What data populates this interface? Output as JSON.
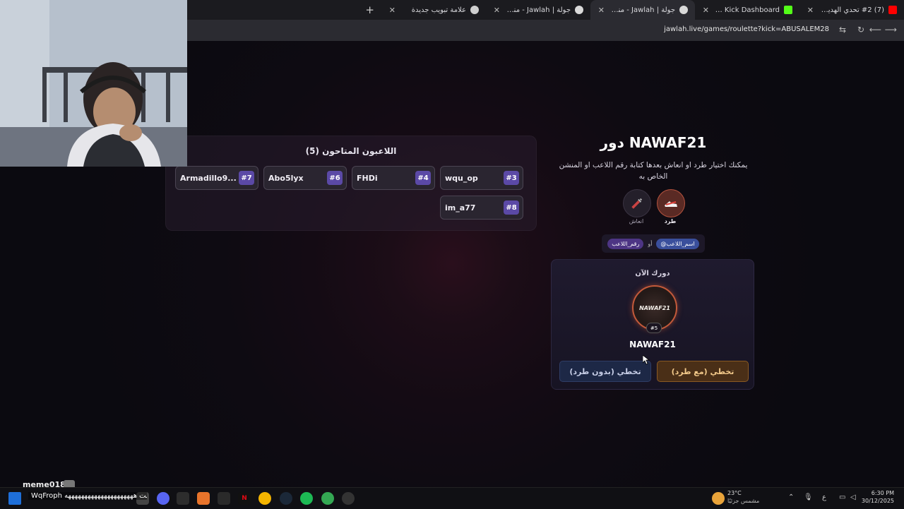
{
  "browser": {
    "tabs": [
      {
        "title": "(7) #2 تحدي الهدية الغامضة بين",
        "favicon_color": "#ff0000",
        "icon": "youtube-icon"
      },
      {
        "title": "Stream - Kick Dashboard",
        "favicon_color": "#53fc18",
        "icon": "kick-icon"
      },
      {
        "title": "جولة | Jawlah - منصة الألعاب الـ",
        "favicon_color": "#d9d9d9",
        "icon": "jawlah-icon",
        "active": true
      },
      {
        "title": "جولة | Jawlah - منصة الألعاب الـ",
        "favicon_color": "#d9d9d9",
        "icon": "jawlah-icon"
      },
      {
        "title": "علامة تبويب جديدة",
        "favicon_color": "#cfcfcf",
        "icon": "chrome-icon"
      }
    ],
    "new_tab_symbol": "+",
    "url": "jawlah.live/games/roulette?kick=ABUSALEM28"
  },
  "players": {
    "title": "اللاعبون المتاحون (5)",
    "list": [
      {
        "name": "wqu_op",
        "num": "#3"
      },
      {
        "name": "FHDi",
        "num": "#4"
      },
      {
        "name": "Abo5lyx",
        "num": "#6"
      },
      {
        "name": "Armadillo9...",
        "num": "#7"
      },
      {
        "name": "im_a77",
        "num": "#8"
      }
    ]
  },
  "turn": {
    "title": "دور NAWAF21",
    "description": "يمكنك اختيار طرد او انعاش بعدها كتابة رقم اللاعب او المنشن الخاص به",
    "options": [
      {
        "label": "طرد",
        "icon": "kick-shoe-icon"
      },
      {
        "label": "انعاش",
        "icon": "syringe-icon"
      }
    ],
    "hint": {
      "chip1": "@اسم_اللاعب",
      "or": "أو",
      "chip2": "رقم_اللاعب"
    }
  },
  "current": {
    "label": "دورك الآن",
    "avatar_text": "NAWAF21",
    "badge": "#5",
    "name": "NAWAF21",
    "skip_with_kick": "تخطي (مع طرد)",
    "skip_without_kick": "تخطي (بدون طرد)"
  },
  "overlay": {
    "chat_user": "meme018",
    "chat_message": "WqFroph كتبت هههههههههههههههههههههه"
  },
  "taskbar": {
    "weather_temp": "23°C",
    "weather_desc": "مشمس جزئيًا",
    "time": "6:30 PM",
    "date": "30/12/2025",
    "lang": "ع"
  }
}
